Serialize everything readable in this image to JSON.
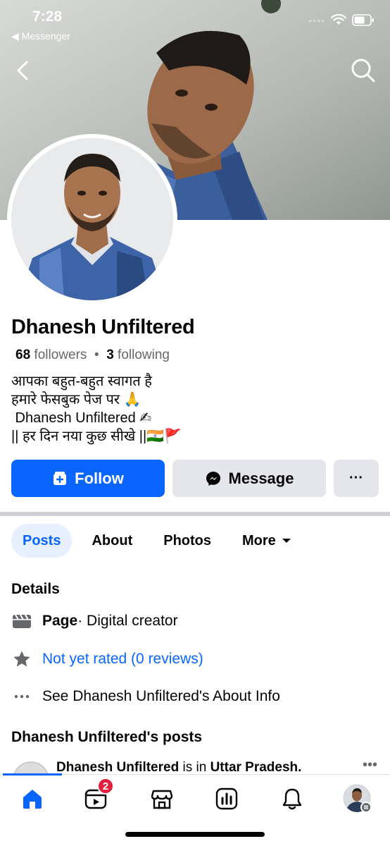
{
  "status": {
    "time": "7:28",
    "back_app": "◀ Messenger"
  },
  "profile": {
    "name": "Dhanesh Unfiltered",
    "followers_count": "68",
    "followers_label": "followers",
    "separator": "•",
    "following_count": "3",
    "following_label": "following",
    "bio": [
      "आपका बहुत-बहुत स्वागत है",
      "हमारे फेसबुक पेज पर 🙏",
      " Dhanesh Unfiltered ✍",
      "|| हर दिन नया कुछ सीखे ||🇮🇳🚩"
    ]
  },
  "actions": {
    "follow": "Follow",
    "message": "Message",
    "more": "···"
  },
  "tabs": [
    "Posts",
    "About",
    "Photos",
    "More"
  ],
  "details": {
    "title": "Details",
    "category_type": "Page",
    "category_value": " · Digital creator",
    "rating": "Not yet rated (0 reviews)",
    "about_info": "See Dhanesh Unfiltered's About Info"
  },
  "posts": {
    "title": "Dhanesh Unfiltered's posts",
    "preview_author": "Dhanesh Unfiltered",
    "preview_text": " is in ",
    "preview_location": "Uttar Pradesh."
  },
  "tabbar": {
    "video_badge": "2"
  },
  "colors": {
    "accent": "#0866ff",
    "badge": "#e41e3f",
    "tab_active_bg": "#e7f0fe"
  },
  "icons": [
    "chevron-left-icon",
    "search-icon",
    "wifi-icon",
    "battery-icon",
    "follow-plus-icon",
    "messenger-icon",
    "clapper-icon",
    "star-icon",
    "more-dots-icon",
    "home-icon",
    "video-icon",
    "marketplace-icon",
    "dashboard-icon",
    "bell-icon"
  ]
}
